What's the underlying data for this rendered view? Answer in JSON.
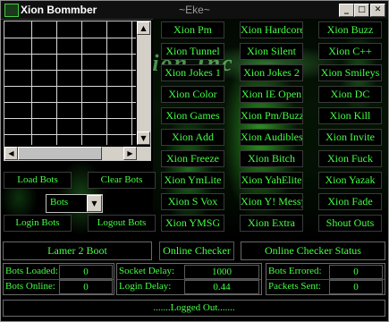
{
  "window": {
    "title": "Xion Bommber",
    "subtitle": "~Eke~",
    "icon": "app-icon",
    "controls": {
      "minimize": "_",
      "maximize": "□",
      "close": "✕"
    }
  },
  "background": {
    "watermark": "Xion Inc"
  },
  "bot_grid": {
    "rows": 7,
    "columns": 5
  },
  "left_buttons": {
    "load_bots": "Load Bots",
    "clear_bots": "Clear Bots",
    "login_bots": "Login Bots",
    "logout_bots": "Logout Bots"
  },
  "bot_type_select": {
    "value": "Bots"
  },
  "actions": [
    "Xion Pm",
    "Xion Hardcore",
    "Xion Buzz",
    "Xion Tunnel",
    "Xion Silent",
    "Xion C++",
    "Xion Jokes 1",
    "Xion Jokes 2",
    "Xion Smileys",
    "Xion Color",
    "Xion IE Open",
    "Xion DC",
    "Xion Games",
    "Xion Pm/Buzz",
    "Xion Kill",
    "Xion Add",
    "Xion Audibles",
    "Xion Invite",
    "Xion Freeze",
    "Xion Bitch",
    "Xion Fuck",
    "Xion YmLite",
    "Xion YahElite",
    "Xion Yazak",
    "Xion S Vox",
    "Xion Y! Messy",
    "Xion Fade",
    "Xion YMSG",
    "Xion Extra",
    "Shout Outs"
  ],
  "bottom_strip": {
    "lamer_boot": "Lamer 2 Boot",
    "online_checker": "Online Checker",
    "online_checker_status": "Online Checker Status"
  },
  "stats": {
    "bots_loaded_label": "Bots Loaded:",
    "bots_loaded": "0",
    "bots_online_label": "Bots Online:",
    "bots_online": "0",
    "socket_delay_label": "Socket Delay:",
    "socket_delay": "1000",
    "login_delay_label": "Login Delay:",
    "login_delay": "0.44",
    "bots_errored_label": "Bots Errored:",
    "bots_errored": "0",
    "packets_sent_label": "Packets Sent:",
    "packets_sent": "0"
  },
  "status_bar": {
    "text": ".......Logged Out......."
  },
  "colors": {
    "accent": "#44ff44",
    "background": "#000000",
    "chrome": "#d4d0c8"
  }
}
